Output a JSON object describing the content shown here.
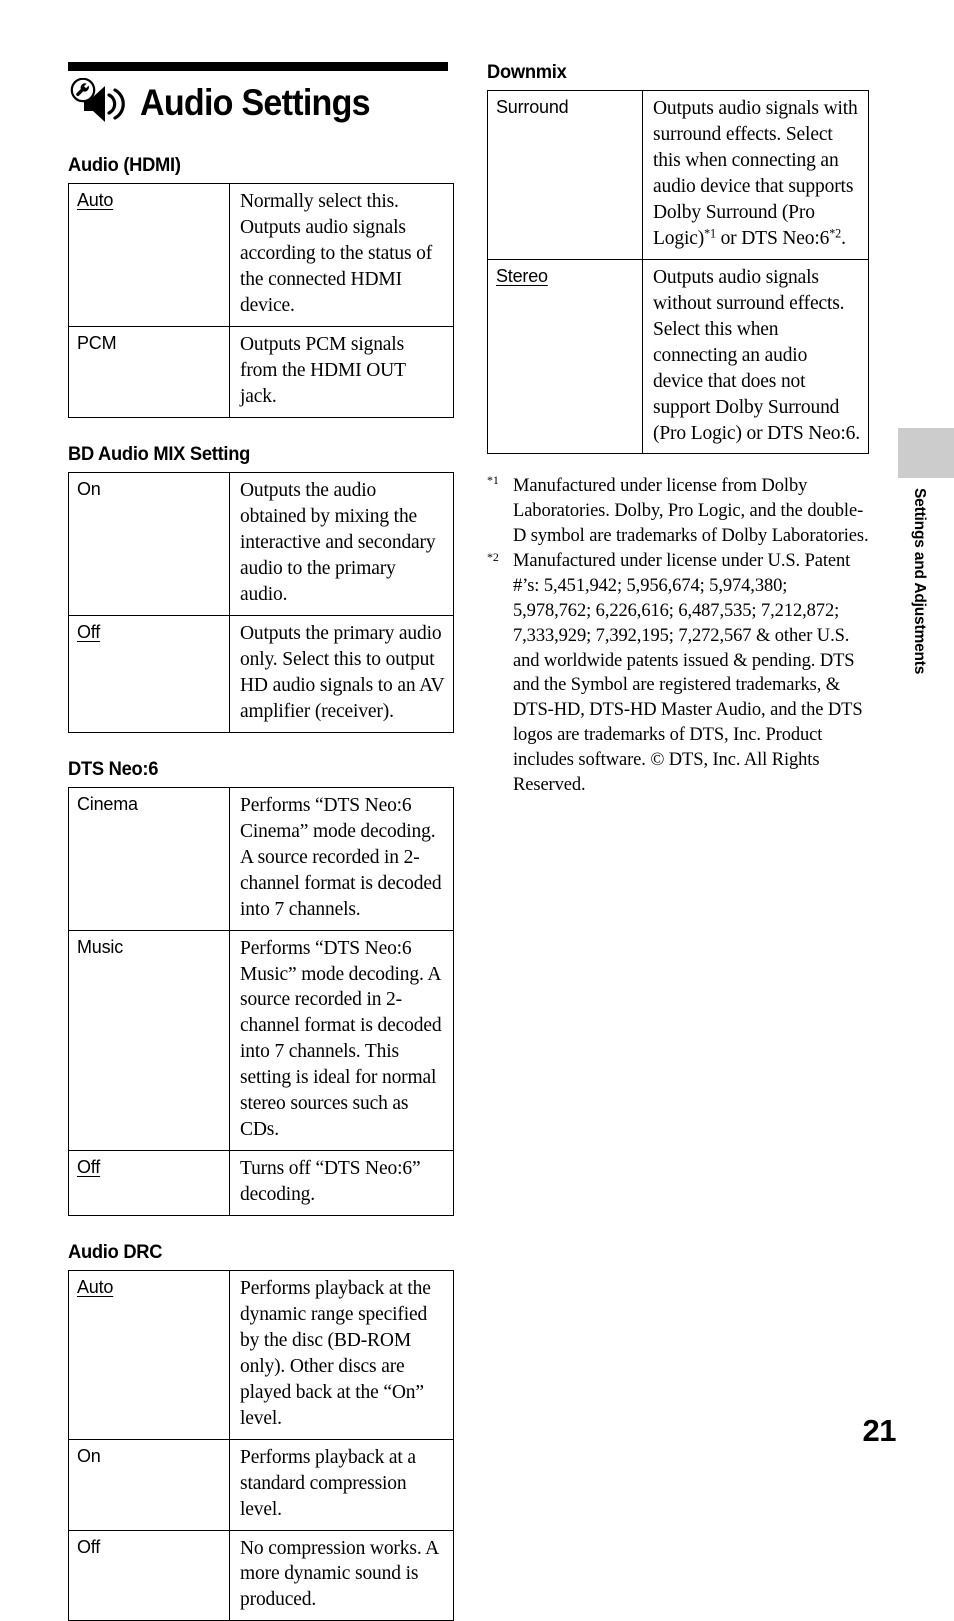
{
  "chapter": {
    "icon": "speaker-wrench-icon",
    "title": "Audio Settings"
  },
  "sections": {
    "audio_hdmi": {
      "heading": "Audio (HDMI)",
      "rows": [
        {
          "key": "Auto",
          "default": true,
          "value": "Normally select this. Outputs audio signals according to the status of the connected HDMI device."
        },
        {
          "key": "PCM",
          "default": false,
          "value": "Outputs PCM signals from the HDMI OUT jack."
        }
      ]
    },
    "bd_audio_mix": {
      "heading": "BD Audio MIX Setting",
      "rows": [
        {
          "key": "On",
          "default": false,
          "value": "Outputs the audio obtained by mixing the interactive and secondary audio to the primary audio."
        },
        {
          "key": "Off",
          "default": true,
          "value": "Outputs the primary audio only. Select this to output HD audio signals to an AV amplifier (receiver)."
        }
      ]
    },
    "dts_neo6": {
      "heading": "DTS Neo:6",
      "rows": [
        {
          "key": "Cinema",
          "default": false,
          "value": "Performs “DTS Neo:6 Cinema” mode decoding. A source recorded in 2-channel format is decoded into 7 channels."
        },
        {
          "key": "Music",
          "default": false,
          "value": "Performs “DTS Neo:6 Music” mode decoding. A source recorded in 2-channel format is decoded into 7 channels. This setting is ideal for normal stereo sources such as CDs."
        },
        {
          "key": "Off",
          "default": true,
          "value": "Turns off “DTS Neo:6” decoding."
        }
      ]
    },
    "audio_drc": {
      "heading": "Audio DRC",
      "rows": [
        {
          "key": "Auto",
          "default": true,
          "value": "Performs playback at the dynamic range specified by the disc (BD-ROM only). Other discs are played back at the “On” level."
        },
        {
          "key": "On",
          "default": false,
          "value": "Performs playback at a standard compression level."
        },
        {
          "key": "Off",
          "default": false,
          "value": "No compression works. A more dynamic sound is produced."
        }
      ]
    },
    "downmix": {
      "heading": "Downmix",
      "rows": [
        {
          "key": "Surround",
          "default": false,
          "value_part1": "Outputs audio signals with surround effects. Select this when connecting an audio device that supports Dolby Surround (Pro Logic)",
          "footnote1": "*1",
          "value_part2": " or DTS Neo:6",
          "footnote2": "*2",
          "value_part3": "."
        },
        {
          "key": "Stereo",
          "default": true,
          "value": "Outputs audio signals without surround effects. Select this when connecting an audio device that does not support Dolby Surround (Pro Logic) or DTS Neo:6."
        }
      ]
    }
  },
  "footnotes": [
    {
      "marker": "*1",
      "text": "Manufactured under license from Dolby Laboratories. Dolby, Pro Logic, and the double-D symbol are trademarks of Dolby Laboratories."
    },
    {
      "marker": "*2",
      "text": "Manufactured under license under U.S. Patent #’s: 5,451,942; 5,956,674; 5,974,380; 5,978,762; 6,226,616; 6,487,535; 7,212,872; 7,333,929; 7,392,195; 7,272,567 & other U.S. and worldwide patents issued & pending. DTS and the Symbol are registered trademarks, & DTS-HD, DTS-HD Master Audio, and the DTS logos are trademarks of DTS, Inc. Product includes software. © DTS, Inc. All Rights Reserved."
    }
  ],
  "side_tab": {
    "label": "Settings and Adjustments",
    "block_color": "#cccccc"
  },
  "page_number": "21"
}
